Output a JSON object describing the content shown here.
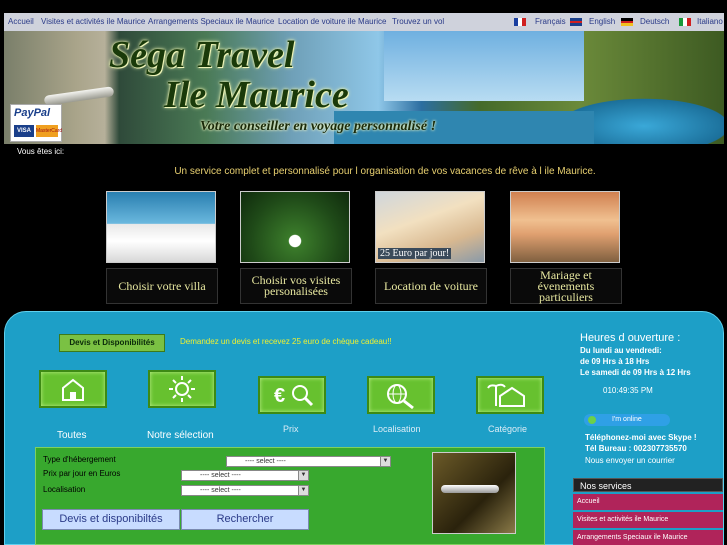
{
  "nav": {
    "items": [
      "Accueil",
      "Visites et activités ile Maurice",
      "Arrangements Speciaux ile Maurice",
      "Location de voiture ile Maurice",
      "Trouvez un vol"
    ],
    "languages": [
      "Français",
      "English",
      "Deutsch",
      "Italiano"
    ]
  },
  "banner": {
    "title_line1": "Séga Travel",
    "title_line2": "Ile Maurice",
    "slogan": "Votre conseiller en voyage personnalisé !",
    "paypal": "PayPal",
    "card1": "VISA",
    "card2": "MasterCard"
  },
  "breadcrumb": "Vous êtes ici:",
  "tagline": "Un service complet et personnalisé pour l organisation de vos vacances de rêve à  l ile Maurice.",
  "tiles": [
    {
      "caption": "Choisir votre villa"
    },
    {
      "caption": "Choisir vos visites personalisées"
    },
    {
      "caption": "Location de voiture",
      "overlay": "25 Euro par jour!"
    },
    {
      "caption": "Mariage et évenements particuliers"
    }
  ],
  "devis": {
    "button": "Devis et Disponibilités",
    "message": "Demandez un devis et recevez 25 euro de chèque cadeau!!"
  },
  "categories": [
    "Toutes",
    "Notre sélection",
    "Prix",
    "Localisation",
    "Catégorie"
  ],
  "form": {
    "type_label": "Type d'hébergement",
    "prix_label": "Prix par jour en Euros",
    "loc_label": "Localisation",
    "select_value": "---- select ----",
    "devis_button": "Devis et disponibiltés",
    "search_button": "Rechercher"
  },
  "hours": {
    "title": "Heures d ouverture :",
    "line1": "Du lundi au vendredi:",
    "line2": "de 09 Hrs à  18 Hrs",
    "line3": "Le samedi de 09 Hrs à  12 Hrs",
    "clock": "010:49:35 PM"
  },
  "skype": {
    "status": "I'm online",
    "line1": "Téléphonez-moi avec Skype !",
    "line2": "Tél Bureau : 002307735570",
    "mail": "Nous envoyer un courrier"
  },
  "services": {
    "title": "Nos services",
    "items": [
      "Accueil",
      "Visites et activités ile Maurice",
      "Arrangements Speciaux ile Maurice"
    ]
  },
  "colors": {
    "panel": "#1d9fc7",
    "accent_green": "#67c12f",
    "service_item": "#b0245a",
    "tagline": "#e8d070"
  }
}
